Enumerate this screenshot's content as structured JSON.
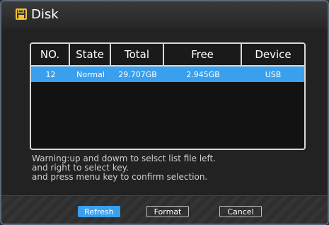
{
  "window": {
    "title": "Disk",
    "icon": "floppy-disk-icon",
    "accent": "#3aa0ee"
  },
  "table": {
    "headers": [
      "NO.",
      "State",
      "Total",
      "Free",
      "Device"
    ],
    "rows": [
      {
        "no": "12",
        "state": "Normal",
        "total": "29.707GB",
        "free": "2.945GB",
        "device": "USB"
      }
    ]
  },
  "warning": {
    "lines": [
      "Warning:up and dowm to selsct list file left.",
      "and right to select key.",
      "and press menu key to confirm selection."
    ]
  },
  "buttons": {
    "refresh": "Refresh",
    "format": "Format",
    "cancel": "Cancel"
  }
}
